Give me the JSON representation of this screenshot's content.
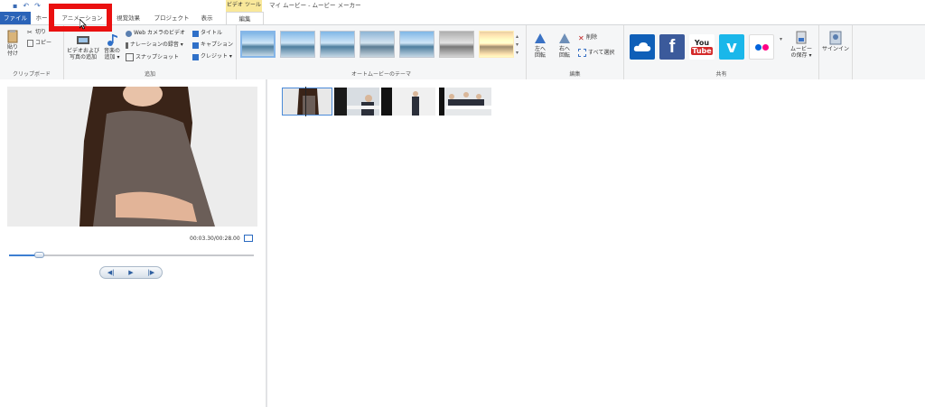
{
  "window": {
    "title": "マイ ムービー - ムービー メーカー",
    "tool_tab": "ビデオ ツール"
  },
  "tabs": {
    "file": "ファイル",
    "home": "ホー",
    "animation": "アニメーション",
    "visual_effects": "視覚効果",
    "project": "プロジェクト",
    "view": "表示",
    "edit": "編集"
  },
  "clipboard": {
    "paste": "貼り\n付け",
    "cut": "切り",
    "copy": "コピー",
    "label": "クリップボード"
  },
  "add": {
    "add_videos_photos": "ビデオおよび\n写真の追加",
    "add_music": "音楽の\n追加 ▾",
    "webcam": "Web カメラのビデオ",
    "narration": "ナレーションの録音 ▾",
    "snapshot": "スナップショット",
    "title": "タイトル",
    "caption": "キャプション",
    "credits": "クレジット ▾",
    "label": "追加"
  },
  "themes": {
    "label": "オートムービーのテーマ",
    "count": 7
  },
  "editing": {
    "rotate_left": "左へ\n回転",
    "rotate_right": "右へ\n回転",
    "delete": "削除",
    "select_all": "すべて選択",
    "label": "編集"
  },
  "share": {
    "onedrive": "OneDrive",
    "facebook": "f",
    "youtube_top": "You",
    "youtube_bottom": "Tube",
    "vimeo": "v",
    "flickr": "flickr",
    "save_movie": "ムービー\nの保存 ▾",
    "label": "共有"
  },
  "signin": {
    "label": "サインイン"
  },
  "preview": {
    "time": "00:03.30/00:28.00",
    "progress": 0.125,
    "prev_frame": "◀|",
    "play": "▶",
    "next_frame": "|▶"
  },
  "colors": {
    "accent": "#2a63b8",
    "highlight": "#ea1010",
    "tool_tab": "#f9e89a"
  }
}
